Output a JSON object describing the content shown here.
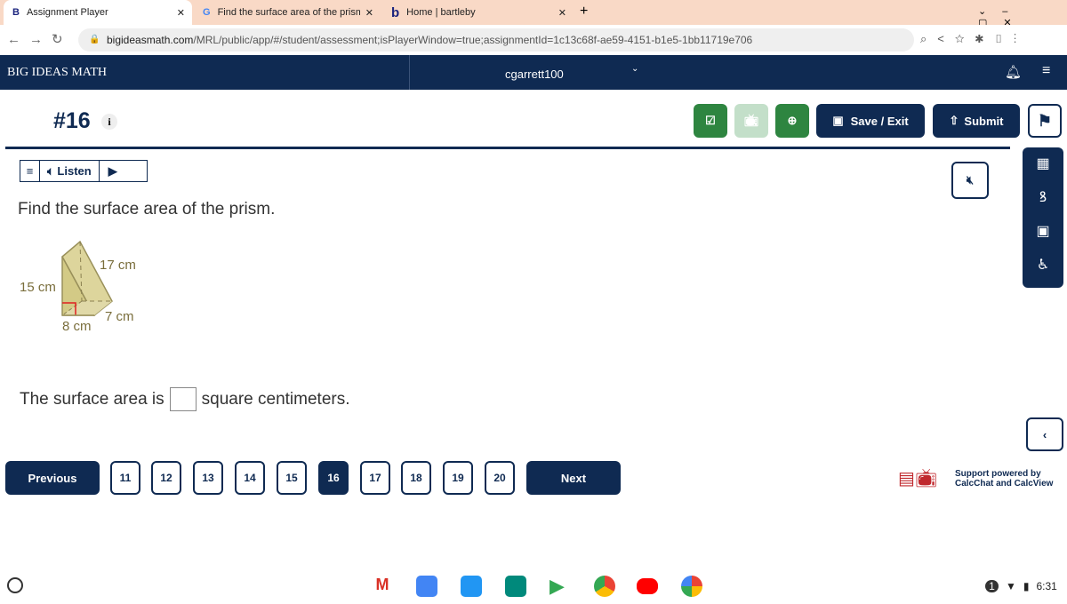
{
  "browser": {
    "tabs": [
      {
        "title": "Assignment Player"
      },
      {
        "title": "Find the surface area of the prism"
      },
      {
        "title": "Home | bartleby"
      }
    ],
    "url_domain": "bigideasmath.com",
    "url_path": "/MRL/public/app/#/student/assessment;isPlayerWindow=true;assignmentId=1c13c68f-ae59-4151-b1e5-1bb11719e706"
  },
  "header": {
    "brand": "BIG IDEAS MATH",
    "user": "cgarrett100"
  },
  "question": {
    "number": "#16",
    "info": "i",
    "listen": "Listen",
    "prompt": "Find the surface area of the prism.",
    "figure": {
      "height": "15 cm",
      "hypotenuse": "17 cm",
      "base": "8 cm",
      "depth": "7 cm"
    },
    "answer_prefix": "The surface area is",
    "answer_value": "",
    "answer_suffix": "square centimeters."
  },
  "toolbar": {
    "save": "Save / Exit",
    "submit": "Submit"
  },
  "pagination": {
    "previous": "Previous",
    "next": "Next",
    "pages": [
      "11",
      "12",
      "13",
      "14",
      "15",
      "16",
      "17",
      "18",
      "19",
      "20"
    ],
    "current": "16"
  },
  "support": {
    "line1": "Support powered by",
    "line2": "CalcChat and CalcView"
  },
  "taskbar": {
    "time": "6:31",
    "notif": "1"
  }
}
